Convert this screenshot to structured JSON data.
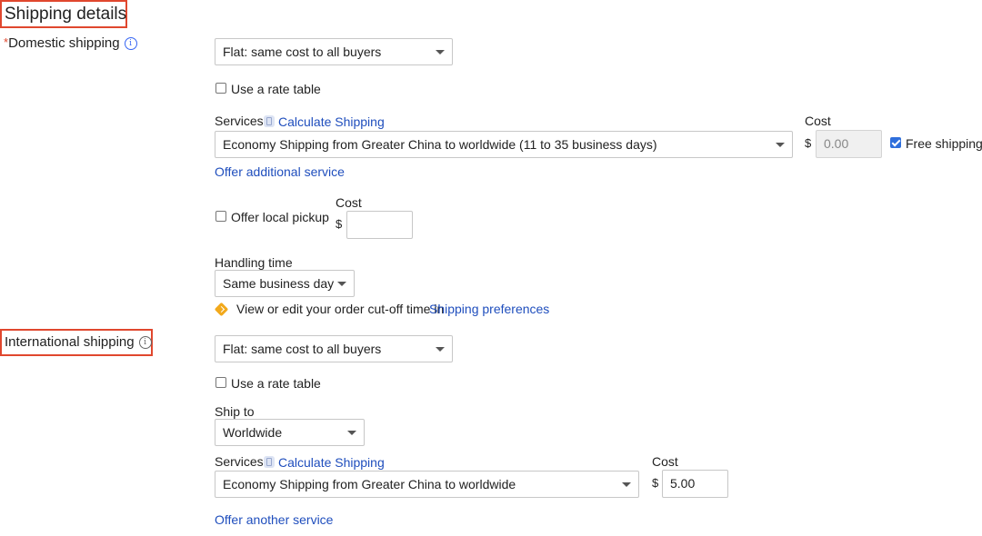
{
  "section": {
    "title": "Shipping details"
  },
  "domestic": {
    "required_mark": "*",
    "label": "Domestic shipping",
    "info_glyph": "i",
    "cost_type": "Flat: same cost to all buyers",
    "rate_table_label": "Use a rate table",
    "rate_table_checked": false,
    "services_label": "Services",
    "calculate_link": "Calculate Shipping",
    "service_selected": "Economy Shipping from Greater China to worldwide (11 to 35 business days)",
    "cost_label": "Cost",
    "currency": "$",
    "cost_value": "0.00",
    "free_shipping_label": "Free shipping",
    "free_shipping_checked": true,
    "offer_additional_link": "Offer additional service",
    "local_pickup_label": "Offer local pickup",
    "local_pickup_checked": false,
    "local_pickup_cost_label": "Cost",
    "local_pickup_currency": "$",
    "local_pickup_cost_value": "",
    "handling_label": "Handling time",
    "handling_value": "Same business day",
    "cutoff_text": "View or edit your order cut-off time in",
    "cutoff_link": "Shipping preferences"
  },
  "international": {
    "label": "International shipping",
    "info_glyph": "i",
    "cost_type": "Flat: same cost to all buyers",
    "rate_table_label": "Use a rate table",
    "rate_table_checked": false,
    "ship_to_label": "Ship to",
    "ship_to_value": "Worldwide",
    "services_label": "Services",
    "calculate_link": "Calculate Shipping",
    "service_selected": "Economy Shipping from Greater China to worldwide",
    "cost_label": "Cost",
    "currency": "$",
    "cost_value": "5.00",
    "offer_another_link": "Offer another service"
  },
  "colors": {
    "highlight_box": "#e0472e",
    "link": "#1f4ebd",
    "info_icon": "#3665f3",
    "warning_icon": "#f2a91c",
    "checkbox_checked": "#2f6fdc"
  }
}
